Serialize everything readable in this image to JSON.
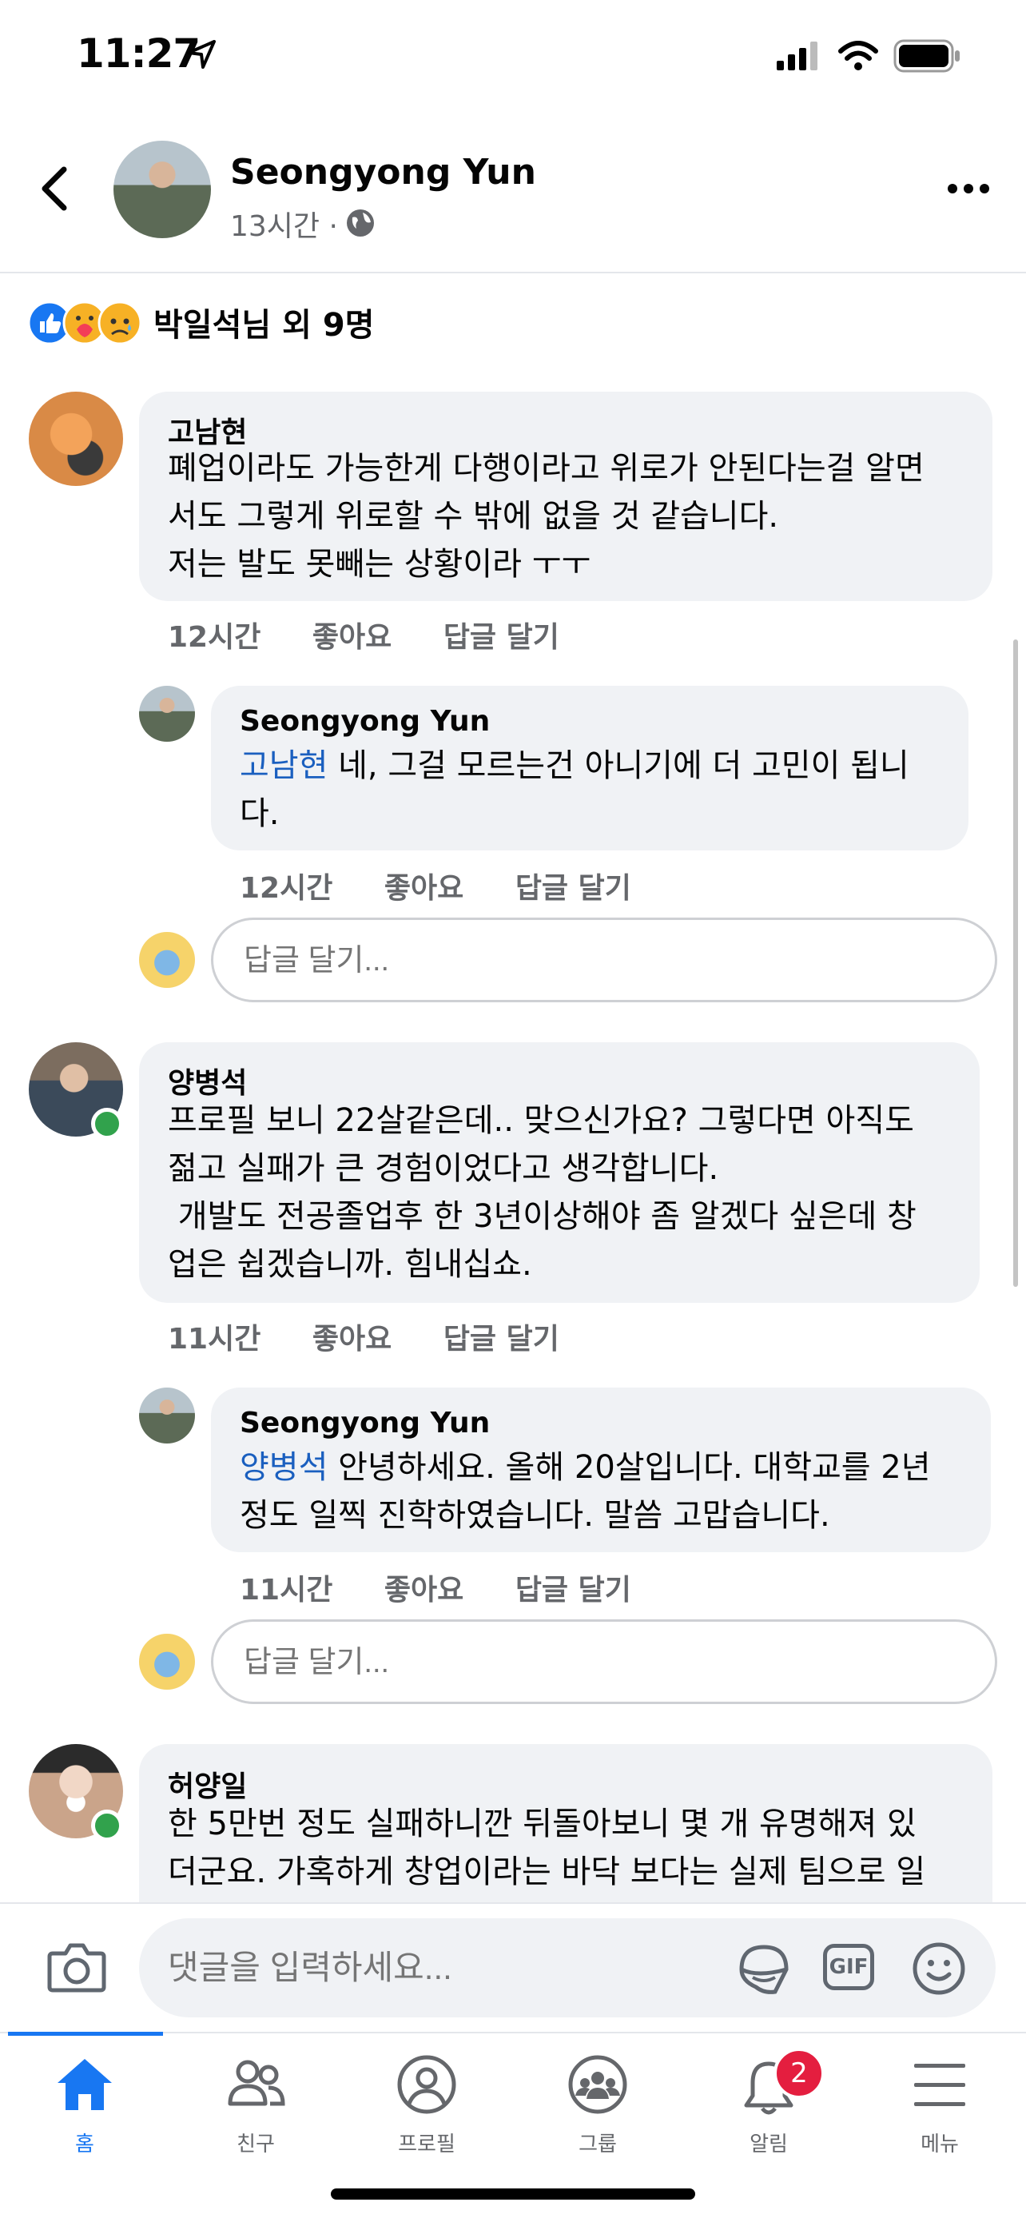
{
  "status_bar": {
    "time": "11:27"
  },
  "post_header": {
    "author": "Seongyong Yun",
    "time": "13시간",
    "dot": "·"
  },
  "reactions": {
    "summary": "박일석님 외 9명"
  },
  "comments": [
    {
      "author": "고남현",
      "text": "폐업이라도 가능한게 다행이라고 위로가 안된다는걸 알면\n서도 그렇게 위로할 수 밖에 없을 것 같습니다.\n저는 발도 못빼는 상황이라 ㅜㅜ",
      "time": "12시간",
      "like": "좋아요",
      "reply": "답글 달기",
      "replies": [
        {
          "author": "Seongyong Yun",
          "mention": "고남현",
          "text": " 네, 그걸 모르는건 아니기에 더 고민이 됩니\n다.",
          "time": "12시간",
          "like": "좋아요",
          "reply": "답글 달기"
        }
      ],
      "reply_placeholder": "답글 달기..."
    },
    {
      "author": "양병석",
      "text": "프로필 보니 22살같은데.. 맞으신가요? 그렇다면 아직도\n젊고 실패가 큰 경험이었다고 생각합니다.\n 개발도 전공졸업후 한 3년이상해야 좀 알겠다 싶은데 창\n업은 쉽겠습니까. 힘내십쇼.",
      "time": "11시간",
      "like": "좋아요",
      "reply": "답글 달기",
      "replies": [
        {
          "author": "Seongyong Yun",
          "mention": "양병석",
          "text": " 안녕하세요. 올해 20살입니다. 대학교를 2년\n정도 일찍 진학하였습니다. 말씀 고맙습니다.",
          "time": "11시간",
          "like": "좋아요",
          "reply": "답글 달기"
        }
      ],
      "reply_placeholder": "답글 달기..."
    },
    {
      "author": "허양일",
      "text": "한 5만번 정도 실패하니깐 뒤돌아보니 몇 개 유명해져 있\n더군요. 가혹하게 창업이라는 바닥 보다는 실제 팀으로 일"
    }
  ],
  "composer": {
    "placeholder": "댓글을 입력하세요...",
    "gif": "GIF"
  },
  "tabbar": {
    "items": [
      {
        "label": "홈",
        "icon": "home-icon"
      },
      {
        "label": "친구",
        "icon": "friends-icon"
      },
      {
        "label": "프로필",
        "icon": "profile-icon"
      },
      {
        "label": "그룹",
        "icon": "groups-icon"
      },
      {
        "label": "알림",
        "icon": "bell-icon",
        "badge": "2"
      },
      {
        "label": "메뉴",
        "icon": "menu-icon"
      }
    ]
  },
  "colors": {
    "accent": "#1877f2",
    "mention": "#1a5fbf",
    "badge": "#e41e3f",
    "bubble": "#f0f2f5",
    "online": "#31a24c"
  }
}
